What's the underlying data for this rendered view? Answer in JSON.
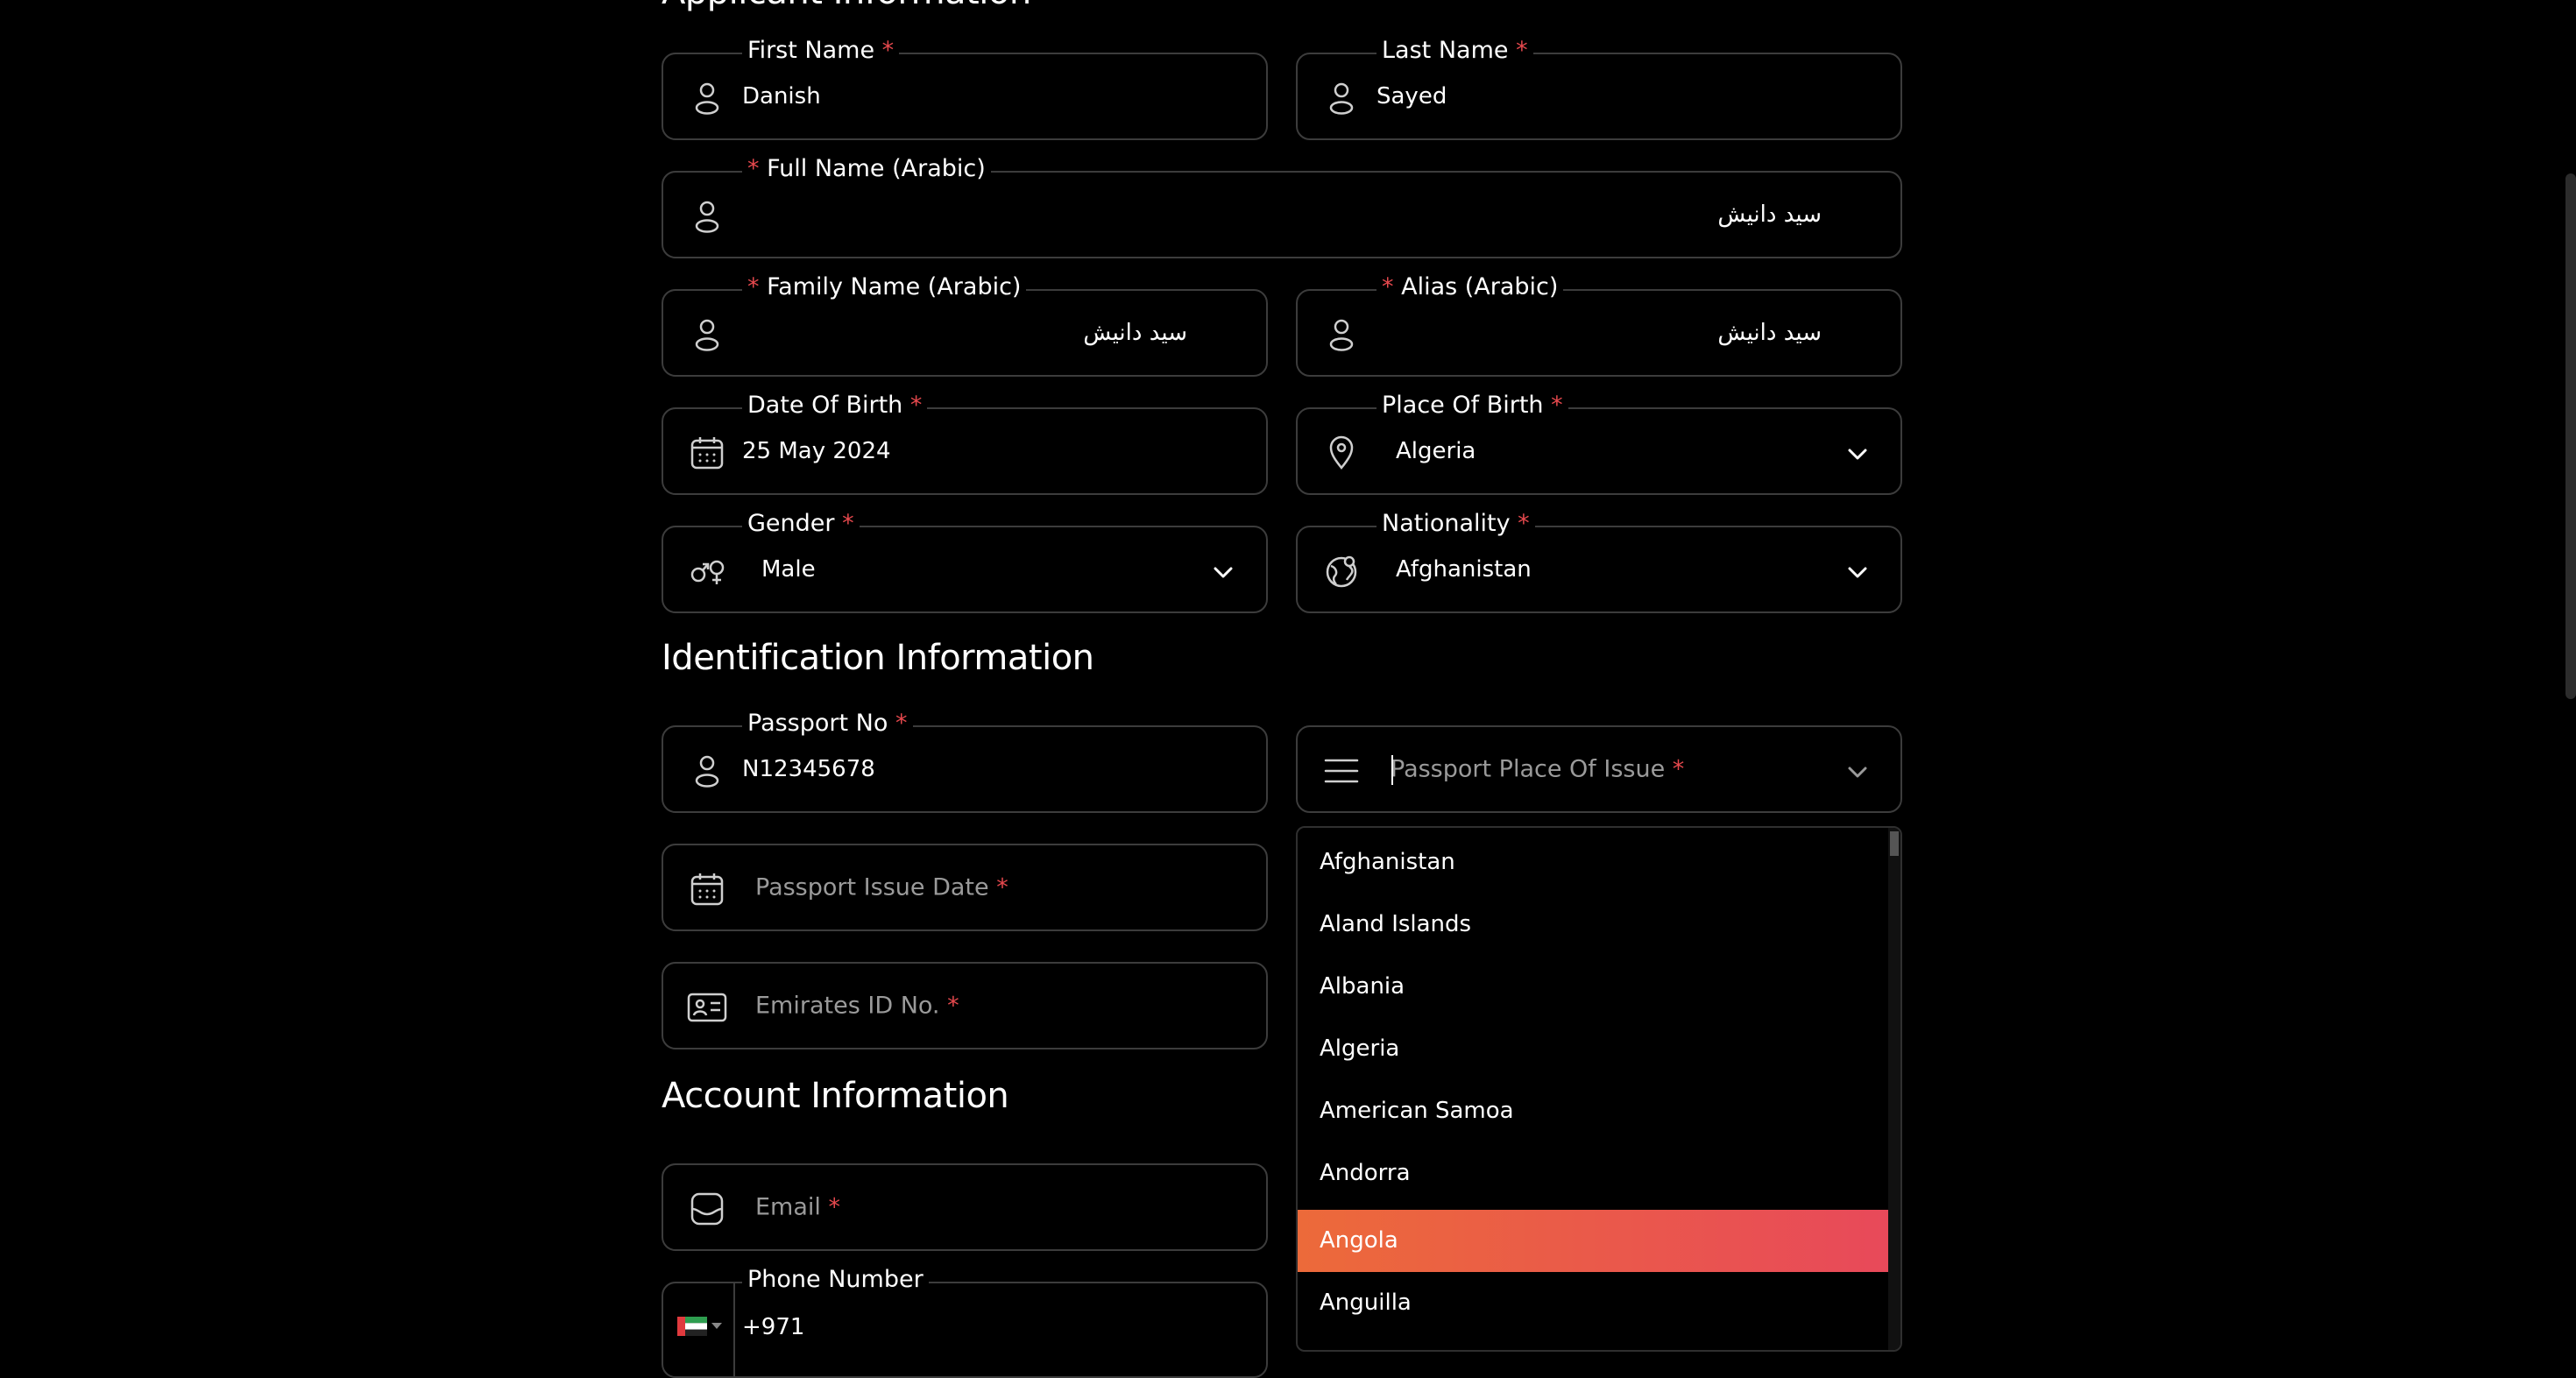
{
  "sections": {
    "applicant_title": "Applicant Information",
    "identification_title": "Identification Information",
    "account_title": "Account Information"
  },
  "fields": {
    "first_name": {
      "label": "First Name",
      "required": "*",
      "value": "Danish"
    },
    "last_name": {
      "label": "Last Name",
      "required": "*",
      "value": "Sayed"
    },
    "full_name_arabic": {
      "label": "Full Name (Arabic)",
      "required": "*",
      "value": "سيد دانيش"
    },
    "family_name_arabic": {
      "label": "Family Name (Arabic)",
      "required": "*",
      "value": "سيد دانيش"
    },
    "alias_arabic": {
      "label": "Alias (Arabic)",
      "required": "*",
      "value": "سيد دانيش"
    },
    "date_of_birth": {
      "label": "Date Of Birth",
      "required": "*",
      "value": "25 May 2024"
    },
    "place_of_birth": {
      "label": "Place Of Birth",
      "required": "*",
      "value": "Algeria"
    },
    "gender": {
      "label": "Gender",
      "required": "*",
      "value": "Male"
    },
    "nationality": {
      "label": "Nationality",
      "required": "*",
      "value": "Afghanistan"
    },
    "passport_no": {
      "label": "Passport No",
      "required": "*",
      "value": "N12345678"
    },
    "passport_place_of_issue": {
      "placeholder": "Passport Place Of Issue",
      "required": "*"
    },
    "passport_issue_date": {
      "placeholder": "Passport Issue Date",
      "required": "*"
    },
    "emirates_id": {
      "placeholder": "Emirates ID No.",
      "required": "*"
    },
    "email": {
      "placeholder": "Email",
      "required": "*"
    },
    "phone_number": {
      "label": "Phone Number",
      "value": "+971"
    }
  },
  "dropdown": {
    "items": [
      "Afghanistan",
      "Aland Islands",
      "Albania",
      "Algeria",
      "American Samoa",
      "Andorra",
      "Angola",
      "Anguilla"
    ],
    "highlighted": "Angola"
  },
  "icons": {
    "person": "user-icon",
    "calendar": "calendar-icon",
    "location": "location-pin-icon",
    "gender": "gender-icon",
    "globe": "globe-icon",
    "menu": "menu-icon",
    "id_card": "id-card-icon",
    "mail": "mail-icon",
    "flag": "uae-flag-icon",
    "chevron": "chevron-down-icon"
  },
  "colors": {
    "background": "#000000",
    "border": "#3c3c3c",
    "required": "#e5484d",
    "highlight_start": "#ec6a3a",
    "highlight_end": "#e8495a",
    "placeholder": "#9a9a9a"
  }
}
